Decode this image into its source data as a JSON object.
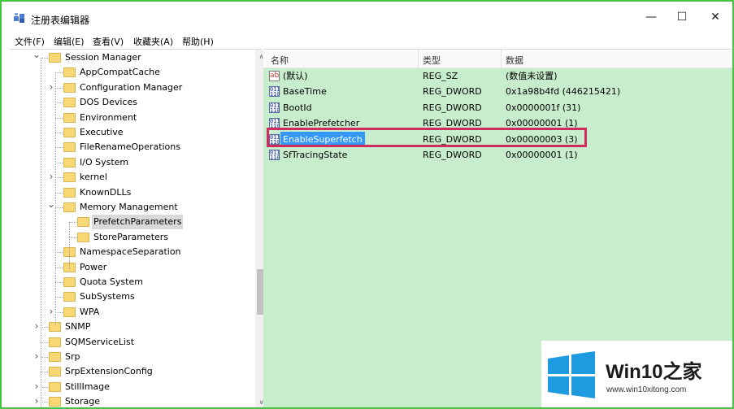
{
  "window": {
    "title": "注册表编辑器",
    "controls": {
      "minimize": "—",
      "maximize": "☐",
      "close": "✕"
    },
    "accent": "#45c53f"
  },
  "menu": [
    "文件(F)",
    "编辑(E)",
    "查看(V)",
    "收藏夹(A)",
    "帮助(H)"
  ],
  "tree": [
    {
      "label": "Session Manager",
      "level": 1,
      "expander": "v"
    },
    {
      "label": "AppCompatCache",
      "level": 2,
      "expander": ""
    },
    {
      "label": "Configuration Manager",
      "level": 2,
      "expander": ">"
    },
    {
      "label": "DOS Devices",
      "level": 2,
      "expander": ""
    },
    {
      "label": "Environment",
      "level": 2,
      "expander": ""
    },
    {
      "label": "Executive",
      "level": 2,
      "expander": ""
    },
    {
      "label": "FileRenameOperations",
      "level": 2,
      "expander": ""
    },
    {
      "label": "I/O System",
      "level": 2,
      "expander": ""
    },
    {
      "label": "kernel",
      "level": 2,
      "expander": ">"
    },
    {
      "label": "KnownDLLs",
      "level": 2,
      "expander": ""
    },
    {
      "label": "Memory Management",
      "level": 2,
      "expander": "v"
    },
    {
      "label": "PrefetchParameters",
      "level": 3,
      "expander": "",
      "selected": true
    },
    {
      "label": "StoreParameters",
      "level": 3,
      "expander": ""
    },
    {
      "label": "NamespaceSeparation",
      "level": 2,
      "expander": ""
    },
    {
      "label": "Power",
      "level": 2,
      "expander": ""
    },
    {
      "label": "Quota System",
      "level": 2,
      "expander": ""
    },
    {
      "label": "SubSystems",
      "level": 2,
      "expander": ""
    },
    {
      "label": "WPA",
      "level": 2,
      "expander": ">"
    },
    {
      "label": "SNMP",
      "level": 1,
      "expander": ">"
    },
    {
      "label": "SQMServiceList",
      "level": 1,
      "expander": ""
    },
    {
      "label": "Srp",
      "level": 1,
      "expander": ">"
    },
    {
      "label": "SrpExtensionConfig",
      "level": 1,
      "expander": ""
    },
    {
      "label": "StillImage",
      "level": 1,
      "expander": ">"
    },
    {
      "label": "Storage",
      "level": 1,
      "expander": ">"
    }
  ],
  "scrollbar": {
    "up": "∧",
    "down": "∨"
  },
  "list": {
    "columns": {
      "name": "名称",
      "type": "类型",
      "data": "数据"
    },
    "rows": [
      {
        "icon": "ab",
        "icon_kind": "string-value-icon",
        "name": "(默认)",
        "type": "REG_SZ",
        "data": "(数值未设置)"
      },
      {
        "icon": "011 110",
        "icon_kind": "dword-value-icon",
        "name": "BaseTime",
        "type": "REG_DWORD",
        "data": "0x1a98b4fd (446215421)"
      },
      {
        "icon": "011 110",
        "icon_kind": "dword-value-icon",
        "name": "BootId",
        "type": "REG_DWORD",
        "data": "0x0000001f (31)"
      },
      {
        "icon": "011 110",
        "icon_kind": "dword-value-icon",
        "name": "EnablePrefetcher",
        "type": "REG_DWORD",
        "data": "0x00000001 (1)"
      },
      {
        "icon": "011 110",
        "icon_kind": "dword-value-icon",
        "name": "EnableSuperfetch",
        "type": "REG_DWORD",
        "data": "0x00000003 (3)",
        "selected": true
      },
      {
        "icon": "011 110",
        "icon_kind": "dword-value-icon",
        "name": "SfTracingState",
        "type": "REG_DWORD",
        "data": "0x00000001 (1)"
      }
    ],
    "background": "#c7edcc",
    "highlight_color": "#d12a5c"
  },
  "watermark": {
    "brand": "Win10",
    "brand_zh": "之家",
    "url": "www.win10xitong.com",
    "logo_color": "#1e9be0"
  }
}
